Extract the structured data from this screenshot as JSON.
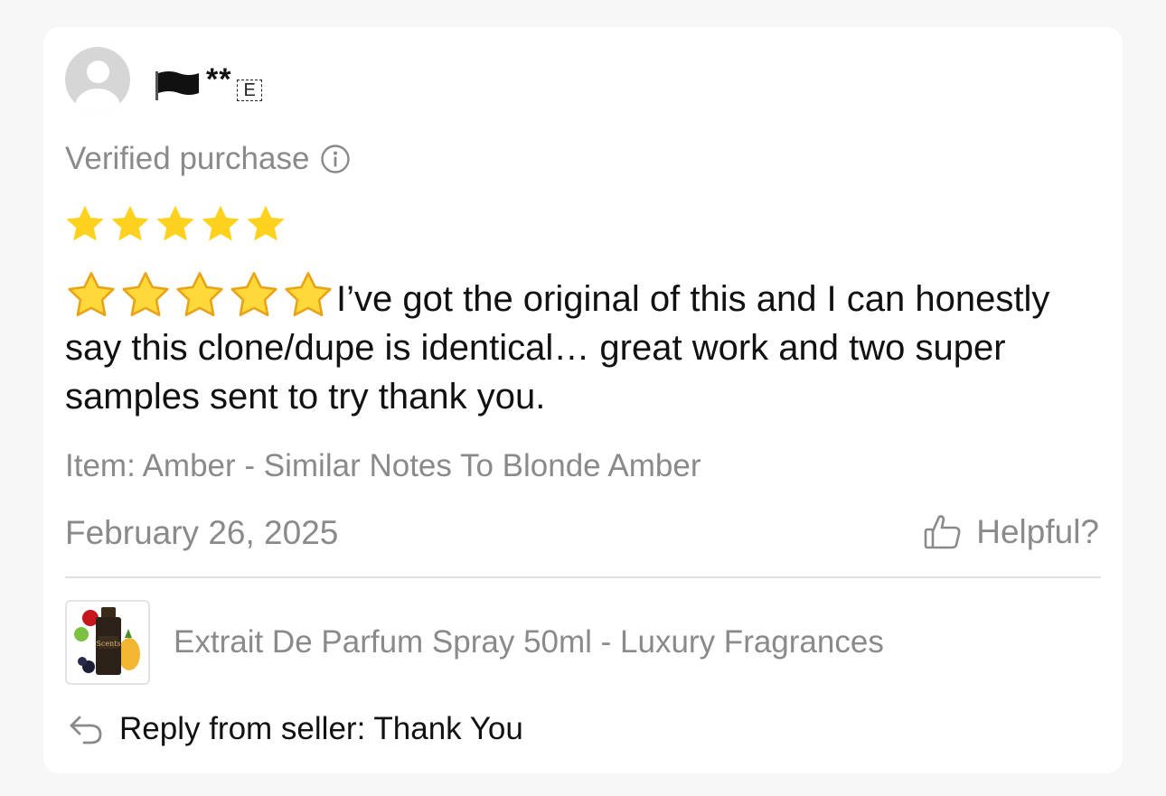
{
  "reviewer": {
    "name_masked": "**",
    "tag": "E",
    "flag_icon": "black-flag-icon",
    "avatar_icon": "default-avatar-icon"
  },
  "verified_label": "Verified purchase",
  "rating": {
    "stars": 5,
    "max": 5,
    "color": "#FFD21F"
  },
  "review": {
    "emoji_stars": 5,
    "text": "I’ve got the original of this and I can honestly say this clone/dupe is identical… great work and two super samples sent to try thank you."
  },
  "item_label": "Item: Amber - Similar Notes To Blonde Amber",
  "date": "February 26, 2025",
  "helpful_label": "Helpful?",
  "product": {
    "title": "Extrait De Parfum Spray 50ml - Luxury Fragrances",
    "thumb_text": "Scents"
  },
  "seller_reply": "Reply from seller: Thank You",
  "colors": {
    "text_primary": "#111111",
    "text_secondary": "#8A8A8A",
    "divider": "#E0E0E0",
    "card": "#FFFFFF"
  }
}
